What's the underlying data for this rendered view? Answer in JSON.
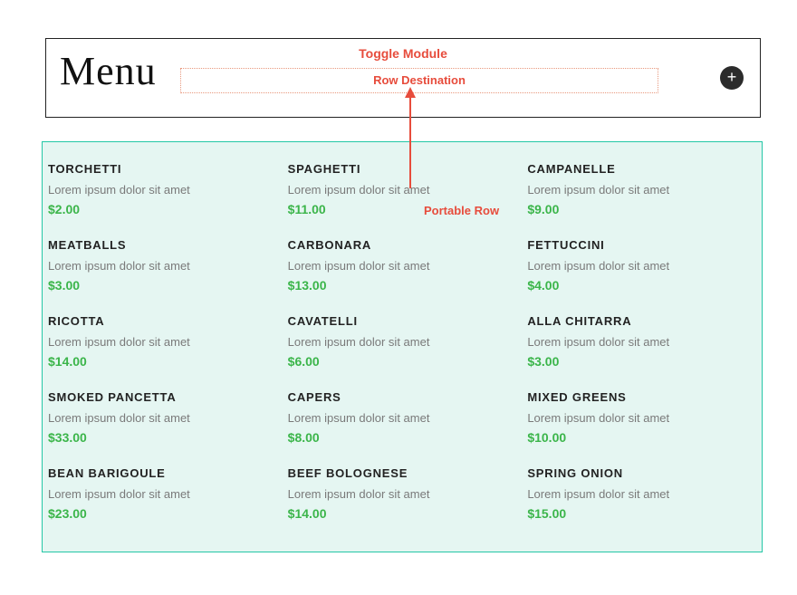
{
  "header": {
    "title": "Menu",
    "toggle_label": "Toggle Module",
    "row_dest_label": "Row Destination",
    "add_label": "+"
  },
  "annotations": {
    "portable_row": "Portable Row"
  },
  "menu": {
    "columns": [
      [
        {
          "name": "TORCHETTI",
          "desc": "Lorem ipsum dolor sit amet",
          "price": "$2.00"
        },
        {
          "name": "MEATBALLS",
          "desc": "Lorem ipsum dolor sit amet",
          "price": "$3.00"
        },
        {
          "name": "RICOTTA",
          "desc": "Lorem ipsum dolor sit amet",
          "price": "$14.00"
        },
        {
          "name": "SMOKED PANCETTA",
          "desc": "Lorem ipsum dolor sit amet",
          "price": "$33.00"
        },
        {
          "name": "BEAN BARIGOULE",
          "desc": "Lorem ipsum dolor sit amet",
          "price": "$23.00"
        }
      ],
      [
        {
          "name": "SPAGHETTI",
          "desc": "Lorem ipsum dolor sit amet",
          "price": "$11.00"
        },
        {
          "name": "CARBONARA",
          "desc": "Lorem ipsum dolor sit amet",
          "price": "$13.00"
        },
        {
          "name": "CAVATELLI",
          "desc": "Lorem ipsum dolor sit amet",
          "price": "$6.00"
        },
        {
          "name": "CAPERS",
          "desc": "Lorem ipsum dolor sit amet",
          "price": "$8.00"
        },
        {
          "name": "BEEF BOLOGNESE",
          "desc": "Lorem ipsum dolor sit amet",
          "price": "$14.00"
        }
      ],
      [
        {
          "name": "CAMPANELLE",
          "desc": "Lorem ipsum dolor sit amet",
          "price": "$9.00"
        },
        {
          "name": "FETTUCCINI",
          "desc": "Lorem ipsum dolor sit amet",
          "price": "$4.00"
        },
        {
          "name": "ALLA CHITARRA",
          "desc": "Lorem ipsum dolor sit amet",
          "price": "$3.00"
        },
        {
          "name": "MIXED GREENS",
          "desc": "Lorem ipsum dolor sit amet",
          "price": "$10.00"
        },
        {
          "name": "SPRING ONION",
          "desc": "Lorem ipsum dolor sit amet",
          "price": "$15.00"
        }
      ]
    ]
  }
}
